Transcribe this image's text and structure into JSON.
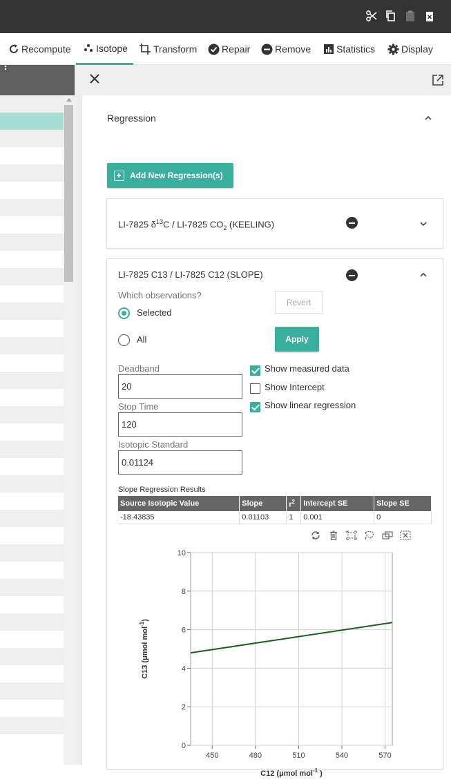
{
  "toolbar": {
    "recompute": "Recompute",
    "isotope": "Isotope",
    "transform": "Transform",
    "repair": "Repair",
    "remove": "Remove",
    "statistics": "Statistics",
    "display": "Display"
  },
  "panel": {
    "section_title": "Regression",
    "add_button": "Add New Regression(s)",
    "regressions": [
      {
        "title_prefix": "LI-7825 δ",
        "title_sup": "13",
        "title_mid": "C / LI-7825 CO",
        "title_sub": "2",
        "title_suffix": " (KEELING)"
      },
      {
        "title": "LI-7825 C13 / LI-7825 C12 (SLOPE)"
      }
    ]
  },
  "form": {
    "which_label": "Which observations?",
    "selected": "Selected",
    "all": "All",
    "revert": "Revert",
    "apply": "Apply",
    "deadband_label": "Deadband",
    "deadband_value": "20",
    "stoptime_label": "Stop Time",
    "stoptime_value": "120",
    "isostd_label": "Isotopic Standard",
    "isostd_value": "0.01124",
    "show_measured": "Show measured data",
    "show_intercept": "Show Intercept",
    "show_linear": "Show linear regression"
  },
  "results": {
    "title": "Slope Regression Results",
    "headers": {
      "source": "Source Isotopic Value",
      "slope": "Slope",
      "r2_base": "r",
      "r2_sup": "2",
      "intercept_se": "Intercept SE",
      "slope_se": "Slope SE"
    },
    "row": {
      "source": "-18.43835",
      "slope": "0.01103",
      "r2": "1",
      "intercept_se": "0.001",
      "slope_se": "0"
    }
  },
  "colors": {
    "accent": "#3aaf9f",
    "line": "#1a5e1a"
  },
  "chart_data": {
    "type": "line",
    "xlabel_base": "C12 (μmol mol",
    "xlabel_sup": "-1",
    "xlabel_close": " )",
    "ylabel_base": "C13 (μmol mol",
    "ylabel_sup": "-1",
    "ylabel_close": ")",
    "xlim": [
      435,
      575
    ],
    "ylim": [
      0,
      10
    ],
    "xticks": [
      "450",
      "480",
      "510",
      "540",
      "570"
    ],
    "yticks": [
      "0",
      "2",
      "4",
      "6",
      "8",
      "10"
    ],
    "series": [
      {
        "x": [
          435,
          575
        ],
        "y": [
          4.8,
          6.37
        ]
      }
    ],
    "grid": true
  }
}
